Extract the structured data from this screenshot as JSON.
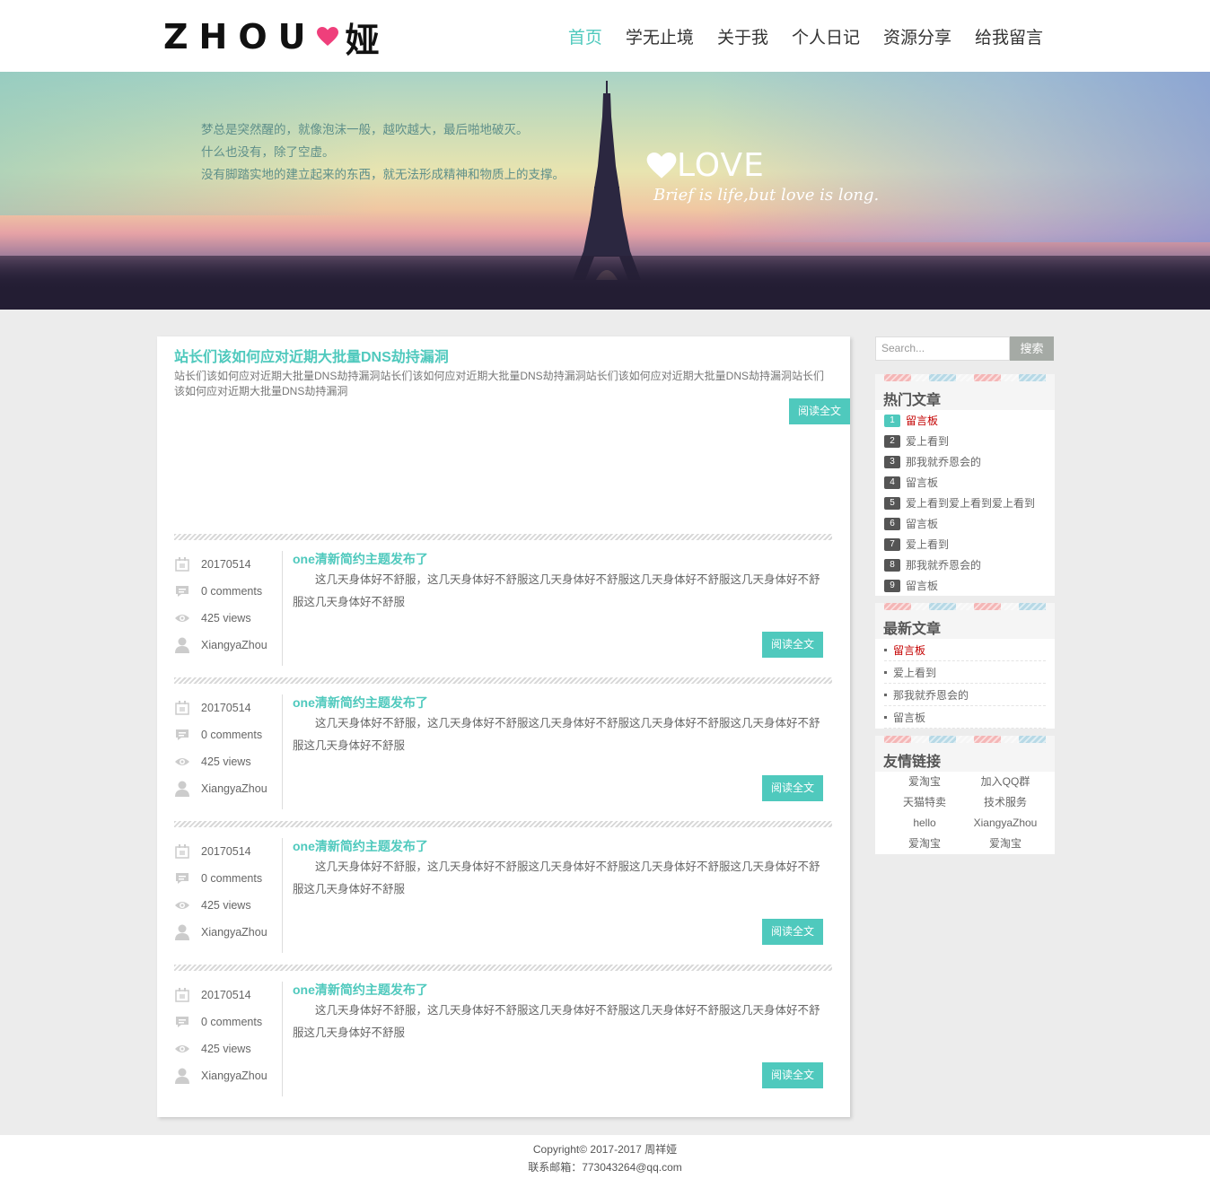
{
  "header": {
    "logo_text": "ZHOU",
    "logo_cn": "娅",
    "nav": [
      "首页",
      "学无止境",
      "关于我",
      "个人日记",
      "资源分享",
      "给我留言"
    ]
  },
  "banner": {
    "quote": [
      "梦总是突然醒的，就像泡沫一般，越吹越大，最后啪地破灭。",
      "什么也没有，除了空虚。",
      "没有脚踏实地的建立起来的东西，就无法形成精神和物质上的支撑。"
    ],
    "love_title": "LOVE",
    "love_sub": "Brief is life,but love is long."
  },
  "feature": {
    "title": "站长们该如何应对近期大批量DNS劫持漏洞",
    "text": "站长们该如何应对近期大批量DNS劫持漏洞站长们该如何应对近期大批量DNS劫持漏洞站长们该如何应对近期大批量DNS劫持漏洞站长们该如何应对近期大批量DNS劫持漏洞",
    "button": "阅读全文"
  },
  "posts": [
    {
      "date": "20170514",
      "comments": "0 comments",
      "views": "425 views",
      "author": "XiangyaZhou",
      "title": "one清新简约主题发布了",
      "text": "这几天身体好不舒服，这几天身体好不舒服这几天身体好不舒服这几天身体好不舒服这几天身体好不舒服这几天身体好不舒服",
      "button": "阅读全文"
    },
    {
      "date": "20170514",
      "comments": "0 comments",
      "views": "425 views",
      "author": "XiangyaZhou",
      "title": "one清新简约主题发布了",
      "text": "这几天身体好不舒服，这几天身体好不舒服这几天身体好不舒服这几天身体好不舒服这几天身体好不舒服这几天身体好不舒服",
      "button": "阅读全文"
    },
    {
      "date": "20170514",
      "comments": "0 comments",
      "views": "425 views",
      "author": "XiangyaZhou",
      "title": "one清新简约主题发布了",
      "text": "这几天身体好不舒服，这几天身体好不舒服这几天身体好不舒服这几天身体好不舒服这几天身体好不舒服这几天身体好不舒服",
      "button": "阅读全文"
    },
    {
      "date": "20170514",
      "comments": "0 comments",
      "views": "425 views",
      "author": "XiangyaZhou",
      "title": "one清新简约主题发布了",
      "text": "这几天身体好不舒服，这几天身体好不舒服这几天身体好不舒服这几天身体好不舒服这几天身体好不舒服这几天身体好不舒服",
      "button": "阅读全文"
    }
  ],
  "search": {
    "placeholder": "Search...",
    "button": "搜索"
  },
  "hot": {
    "title": "热门文章",
    "items": [
      {
        "num": "1",
        "label": "留言板"
      },
      {
        "num": "2",
        "label": "爱上看到"
      },
      {
        "num": "3",
        "label": "那我就乔恩会的"
      },
      {
        "num": "4",
        "label": "留言板"
      },
      {
        "num": "5",
        "label": "爱上看到爱上看到爱上看到"
      },
      {
        "num": "6",
        "label": "留言板"
      },
      {
        "num": "7",
        "label": "爱上看到"
      },
      {
        "num": "8",
        "label": "那我就乔恩会的"
      },
      {
        "num": "9",
        "label": "留言板"
      }
    ]
  },
  "latest": {
    "title": "最新文章",
    "items": [
      "留言板",
      "爱上看到",
      "那我就乔恩会的",
      "留言板"
    ]
  },
  "links": {
    "title": "友情链接",
    "items": [
      "爱淘宝",
      "加入QQ群",
      "天猫特卖",
      "技术服务",
      "hello",
      "XiangyaZhou",
      "爱淘宝",
      "爱淘宝"
    ]
  },
  "footer": {
    "copyright": "Copyright© 2017-2017 周祥娅",
    "email": "联系邮箱：773043264@qq.com"
  },
  "colors": {
    "accent": "#4fc9bd",
    "hot_red": "#c40000",
    "logo_heart": "#ef3f7b"
  }
}
